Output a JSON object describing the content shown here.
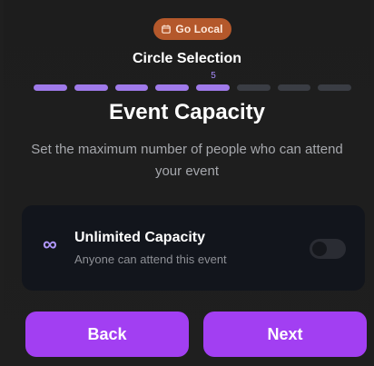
{
  "badge": {
    "label": "Go Local",
    "icon": "calendar-icon",
    "color": "#b4582b"
  },
  "header": {
    "circle_title": "Circle Selection",
    "step_number": "5"
  },
  "progress": {
    "total_steps": 8,
    "completed_steps": 5,
    "active_color": "#9f7aea",
    "inactive_color": "#3a3d44"
  },
  "page": {
    "title": "Event Capacity",
    "subtitle": "Set the maximum number of people who can attend your event"
  },
  "capacity_card": {
    "icon": "infinity-icon",
    "icon_glyph": "∞",
    "title": "Unlimited Capacity",
    "subtitle": "Anyone can attend this event",
    "toggle_on": false
  },
  "buttons": {
    "back_label": "Back",
    "next_label": "Next",
    "color": "#a23ff2"
  }
}
